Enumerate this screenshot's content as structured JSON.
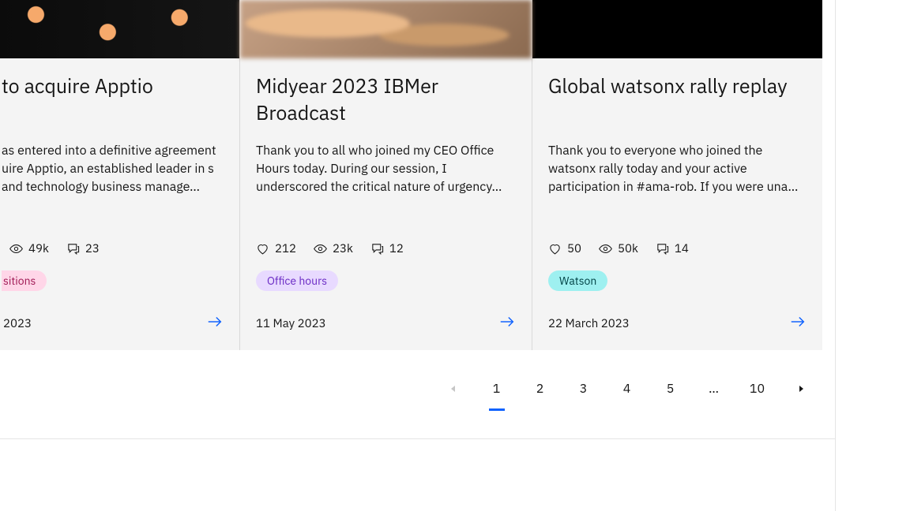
{
  "cards": [
    {
      "title": "to acquire Apptio",
      "desc": "as entered into a definitive agreement uire Apptio, an established leader in s and technology business manage…",
      "likes": "",
      "views": "49k",
      "comments": "23",
      "tag": "sitions",
      "date": "2023"
    },
    {
      "title": "Midyear 2023 IBMer Broadcast",
      "desc": "Thank you to all who joined my CEO Office Hours today. During our session, I underscored the critical nature of urgency…",
      "likes": "212",
      "views": "23k",
      "comments": "12",
      "tag": "Office hours",
      "date": "11 May 2023"
    },
    {
      "title": "Global watsonx rally replay",
      "desc": "Thank you to everyone who joined the watsonx rally today and your active participation in #ama-rob. If you were una…",
      "likes": "50",
      "views": "50k",
      "comments": "14",
      "tag": "Watson",
      "date": "22 March 2023"
    }
  ],
  "pagination": {
    "pages": [
      "1",
      "2",
      "3",
      "4",
      "5",
      "…",
      "10"
    ],
    "current": "1"
  }
}
